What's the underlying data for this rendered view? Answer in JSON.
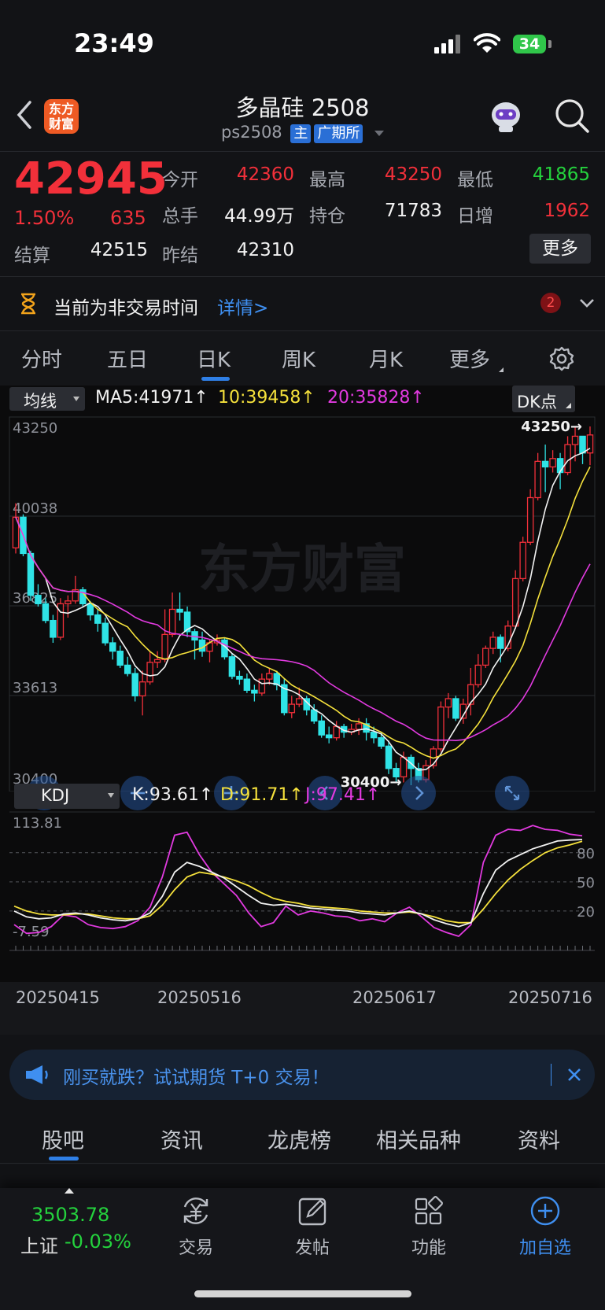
{
  "status_bar": {
    "time": "23:49",
    "battery": "34"
  },
  "header": {
    "title": "多晶硅 2508",
    "code": "ps2508",
    "tag_main": "主",
    "tag_exchange": "广期所",
    "logo_text": "东方财富"
  },
  "quote": {
    "price": "42945",
    "change_pct": "1.50%",
    "change": "635",
    "open_label": "今开",
    "open": "42360",
    "high_label": "最高",
    "high": "43250",
    "low_label": "最低",
    "low": "41865",
    "volume_label": "总手",
    "volume": "44.99万",
    "position_label": "持仓",
    "position": "71783",
    "daily_inc_label": "日增",
    "daily_inc": "1962",
    "settle_label": "结算",
    "settle": "42515",
    "prev_settle_label": "昨结",
    "prev_settle": "42310",
    "more_label": "更多"
  },
  "notice": {
    "text": "当前为非交易时间",
    "link": "详情>",
    "badge": "2"
  },
  "period_tabs": [
    "分时",
    "五日",
    "日K",
    "周K",
    "月K",
    "更多"
  ],
  "active_period": "日K",
  "kline": {
    "indicator_select": "均线",
    "dk_select": "DK点",
    "ma5_label": "MA5:41971↑",
    "ma10_label": "10:39458↑",
    "ma20_label": "20:35828↑",
    "y_ticks": [
      "43250",
      "40038",
      "36825",
      "33613",
      "30400"
    ],
    "high_marker": "43250→",
    "low_marker": "30400→",
    "watermark": "东方财富"
  },
  "kdj": {
    "select": "KDJ",
    "k_label": "K:93.61↑",
    "d_label": "D:91.71↑",
    "j_label": "J:97.41↑",
    "y_top": "113.81",
    "y_bottom": "-7.59",
    "ref_lines": [
      "80",
      "50",
      "20"
    ]
  },
  "x_dates": [
    "20250415",
    "20250516",
    "20250617",
    "20250716"
  ],
  "colors": {
    "up": "#f2303a",
    "down": "#2fe3e6",
    "ma5": "#f2f2f2",
    "ma10": "#f5e13c",
    "ma20": "#e23ae0"
  },
  "chart_data": {
    "type": "candlestick",
    "ylim": [
      30400,
      43250
    ],
    "candles": [
      [
        38900,
        40000,
        40500,
        38700
      ],
      [
        40000,
        38700,
        40100,
        38600
      ],
      [
        38700,
        37200,
        38800,
        37000
      ],
      [
        37200,
        36900,
        37600,
        36800
      ],
      [
        36900,
        36300,
        37100,
        36200
      ],
      [
        36300,
        35700,
        36500,
        35500
      ],
      [
        35700,
        36900,
        37100,
        35600
      ],
      [
        36900,
        37000,
        37200,
        36400
      ],
      [
        37000,
        37400,
        37900,
        36900
      ],
      [
        37400,
        36900,
        37500,
        36800
      ],
      [
        36900,
        36500,
        37000,
        36300
      ],
      [
        36500,
        36200,
        36700,
        35900
      ],
      [
        36200,
        35500,
        36400,
        35400
      ],
      [
        35500,
        35200,
        35700,
        34900
      ],
      [
        35200,
        34700,
        35400,
        34600
      ],
      [
        34700,
        34400,
        35000,
        34300
      ],
      [
        34400,
        33600,
        34600,
        33400
      ],
      [
        33600,
        34100,
        34500,
        32900
      ],
      [
        34100,
        34800,
        35200,
        34000
      ],
      [
        34800,
        34900,
        35200,
        34600
      ],
      [
        34900,
        35800,
        36700,
        34800
      ],
      [
        35800,
        36700,
        37300,
        35700
      ],
      [
        36700,
        36600,
        37300,
        36300
      ],
      [
        36600,
        35900,
        36800,
        35700
      ],
      [
        35900,
        35600,
        36000,
        34900
      ],
      [
        35600,
        35200,
        35900,
        35000
      ],
      [
        35200,
        35500,
        35600,
        34800
      ],
      [
        35500,
        35600,
        35800,
        35400
      ],
      [
        35600,
        35000,
        35700,
        34900
      ],
      [
        35000,
        34300,
        35100,
        34200
      ],
      [
        34300,
        34200,
        34500,
        34000
      ],
      [
        34200,
        33800,
        34400,
        33700
      ],
      [
        33800,
        33700,
        34000,
        33400
      ],
      [
        33700,
        34200,
        34400,
        33600
      ],
      [
        34200,
        34400,
        34600,
        34000
      ],
      [
        34400,
        34000,
        34500,
        33800
      ],
      [
        34000,
        33000,
        34200,
        32900
      ],
      [
        33000,
        33300,
        33600,
        32800
      ],
      [
        33300,
        33500,
        33900,
        33200
      ],
      [
        33500,
        33100,
        33600,
        32900
      ],
      [
        33100,
        32700,
        33300,
        32600
      ],
      [
        32700,
        32200,
        32900,
        32100
      ],
      [
        32200,
        32100,
        32500,
        31900
      ],
      [
        32100,
        32500,
        32700,
        32000
      ],
      [
        32500,
        32300,
        32600,
        32100
      ],
      [
        32300,
        32400,
        32600,
        32200
      ],
      [
        32400,
        32600,
        32800,
        32200
      ],
      [
        32600,
        32300,
        32800,
        32000
      ],
      [
        32300,
        32100,
        32500,
        31900
      ],
      [
        32100,
        31800,
        32300,
        31700
      ],
      [
        31800,
        31000,
        32000,
        30800
      ],
      [
        31000,
        30700,
        31200,
        30500
      ],
      [
        30700,
        31400,
        31600,
        30500
      ],
      [
        31400,
        31000,
        31500,
        30400
      ],
      [
        31000,
        30600,
        31200,
        30500
      ],
      [
        30600,
        31100,
        31300,
        30500
      ],
      [
        31100,
        31700,
        31800,
        31000
      ],
      [
        31700,
        33200,
        33400,
        31600
      ],
      [
        33200,
        33500,
        33700,
        32800
      ],
      [
        33500,
        32800,
        33600,
        32700
      ],
      [
        32800,
        33300,
        33500,
        32600
      ],
      [
        33300,
        34000,
        34600,
        32900
      ],
      [
        34000,
        34700,
        35100,
        33900
      ],
      [
        34700,
        35300,
        35400,
        34600
      ],
      [
        35300,
        35700,
        35900,
        35100
      ],
      [
        35700,
        35300,
        35800,
        34800
      ],
      [
        35300,
        36100,
        36300,
        35200
      ],
      [
        36100,
        37800,
        38100,
        36000
      ],
      [
        37800,
        39100,
        39300,
        37700
      ],
      [
        39100,
        40700,
        41000,
        39000
      ],
      [
        40700,
        42000,
        42300,
        40600
      ],
      [
        42000,
        41800,
        42600,
        40900
      ],
      [
        41800,
        42100,
        42400,
        41600
      ],
      [
        42100,
        41600,
        42300,
        41000
      ],
      [
        41600,
        42600,
        42900,
        41500
      ],
      [
        42600,
        42900,
        43250,
        42000
      ],
      [
        42900,
        42300,
        42900,
        41900
      ],
      [
        42300,
        42945,
        43250,
        41865
      ]
    ],
    "k": [
      20,
      14,
      12,
      13,
      17,
      18,
      16,
      13,
      11,
      10,
      12,
      18,
      35,
      60,
      70,
      66,
      60,
      54,
      45,
      36,
      28,
      26,
      27,
      25,
      23,
      22,
      21,
      20,
      18,
      17,
      16,
      18,
      20,
      17,
      11,
      7,
      4,
      8,
      38,
      62,
      72,
      78,
      84,
      88,
      92,
      93,
      93.6
    ],
    "d": [
      25,
      20,
      17,
      16,
      16,
      17,
      17,
      15,
      13,
      12,
      12,
      15,
      26,
      42,
      55,
      60,
      58,
      55,
      51,
      46,
      39,
      33,
      30,
      28,
      25,
      24,
      23,
      22,
      20,
      19,
      18,
      18,
      19,
      17,
      14,
      10,
      8,
      8,
      22,
      38,
      52,
      63,
      72,
      80,
      85,
      88,
      91.7
    ],
    "j": [
      6,
      -3,
      -2,
      4,
      16,
      14,
      6,
      3,
      2,
      4,
      10,
      24,
      55,
      98,
      101,
      78,
      60,
      48,
      36,
      18,
      4,
      8,
      25,
      16,
      20,
      18,
      15,
      14,
      10,
      12,
      9,
      18,
      24,
      14,
      3,
      -2,
      -6,
      6,
      70,
      98,
      104,
      103,
      108,
      104,
      103,
      99,
      97.4
    ]
  },
  "banner": {
    "text": "刚买就跌？试试期货 T+0 交易！"
  },
  "bottom_tabs": [
    "股吧",
    "资讯",
    "龙虎榜",
    "相关品种",
    "资料"
  ],
  "active_bottom_tab": "股吧",
  "bottom_bar": {
    "index_value": "3503.78",
    "index_name": "上证",
    "index_change": "-0.03%",
    "nav": [
      "交易",
      "发帖",
      "功能",
      "加自选"
    ]
  }
}
